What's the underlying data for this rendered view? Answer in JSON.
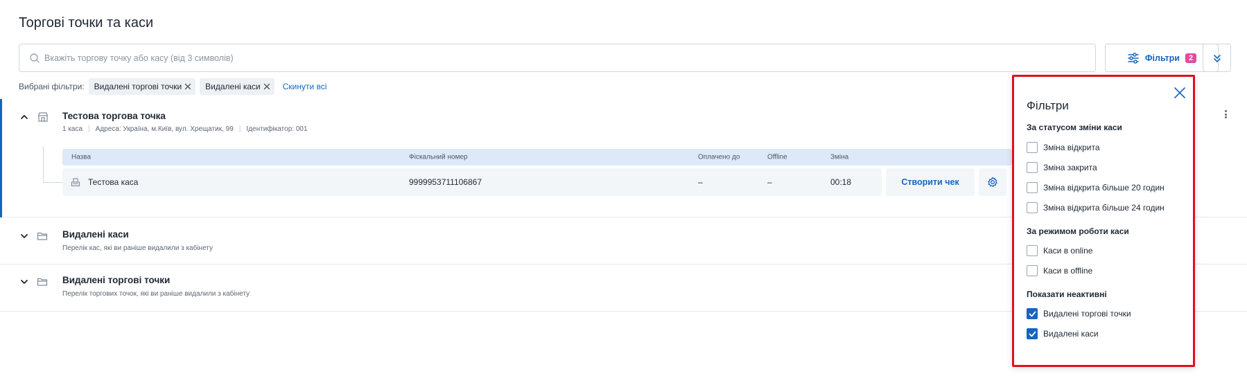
{
  "page": {
    "title": "Торгові точки та каси"
  },
  "search": {
    "placeholder": "Вкажіть торгову точку або касу (від 3 символів)",
    "value": ""
  },
  "toolbar": {
    "filters_label": "Фільтри",
    "filters_count": "2"
  },
  "selected_filters": {
    "label": "Вибрані фільтри:",
    "chips": [
      "Видалені торгові точки",
      "Видалені каси"
    ],
    "reset_label": "Скинути всі"
  },
  "store": {
    "name": "Тестова торгова точка",
    "till_count": "1 каса",
    "address": "Адреса: Україна, м.Київ, вул. Хрещатик, 99",
    "identifier": "Ідентифікатор: 001",
    "table": {
      "columns": [
        "Назва",
        "Фіскальний номер",
        "Оплачено до",
        "Offline",
        "Зміна"
      ],
      "rows": [
        {
          "name": "Тестова каса",
          "fiscal_number": "9999953711106867",
          "paid_until": "–",
          "offline": "–",
          "shift": "00:18"
        }
      ]
    },
    "create_receipt_label": "Створити чек"
  },
  "groups": [
    {
      "title": "Видалені каси",
      "description": "Перелік кас, які ви раніше видалили з кабінету"
    },
    {
      "title": "Видалені торгові точки",
      "description": "Перелік торгових точок, які ви раніше видалили з кабінету"
    }
  ],
  "filter_panel": {
    "title": "Фільтри",
    "sections": [
      {
        "title": "За статусом зміни каси",
        "options": [
          {
            "label": "Зміна відкрита",
            "checked": false
          },
          {
            "label": "Зміна закрита",
            "checked": false
          },
          {
            "label": "Зміна відкрита більше 20 годин",
            "checked": false
          },
          {
            "label": "Зміна відкрита більше 24 годин",
            "checked": false
          }
        ]
      },
      {
        "title": "За режимом роботи каси",
        "options": [
          {
            "label": "Каси в online",
            "checked": false
          },
          {
            "label": "Каси в offline",
            "checked": false
          }
        ]
      },
      {
        "title": "Показати неактивні",
        "options": [
          {
            "label": "Видалені торгові точки",
            "checked": true
          },
          {
            "label": "Видалені каси",
            "checked": true
          }
        ]
      }
    ]
  },
  "colors": {
    "accent": "#1565c0",
    "badge": "#e5499b",
    "highlight_border": "#e0101c"
  },
  "icons": [
    "search-icon",
    "filter-sliders-icon",
    "double-chevron-down-icon",
    "close-icon",
    "chevron-up-icon",
    "chevron-down-icon",
    "store-icon",
    "folder-icon",
    "cash-register-icon",
    "gear-icon",
    "more-vertical-icon",
    "checkmark-icon"
  ]
}
